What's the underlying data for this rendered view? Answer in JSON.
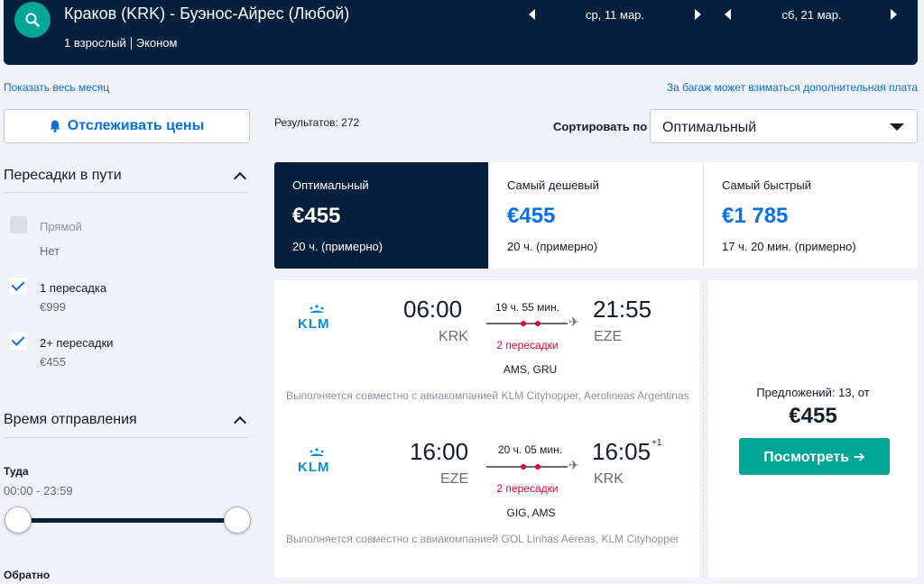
{
  "header": {
    "route": "Краков (KRK) - Буэнос-Айрес (Любой)",
    "passengers": "1 взрослый",
    "cabin": "Эконом",
    "depart_date": "ср, 11 мар.",
    "return_date": "сб, 21 мар."
  },
  "links": {
    "whole_month": "Показать весь месяц",
    "baggage_note": "За багаж может взиматься дополнительная плата"
  },
  "track_button": "Отслеживать цены",
  "filters": {
    "stops": {
      "title": "Пересадки в пути",
      "options": [
        {
          "label": "Прямой",
          "price": "Нет",
          "checked": false
        },
        {
          "label": "1 пересадка",
          "price": "€999",
          "checked": true
        },
        {
          "label": "2+ пересадки",
          "price": "€455",
          "checked": true
        }
      ]
    },
    "departure_time": {
      "title": "Время отправления",
      "outbound_label": "Туда",
      "outbound_range": "00:00 - 23:59",
      "return_label": "Обратно"
    }
  },
  "results": {
    "count_text": "Результатов: 272",
    "sort_label": "Сортировать по",
    "sort_value": "Оптимальный"
  },
  "tabs": [
    {
      "label": "Оптимальный",
      "price": "€455",
      "duration": "20 ч. (примерно)"
    },
    {
      "label": "Самый дешевый",
      "price": "€455",
      "duration": "20 ч. (примерно)"
    },
    {
      "label": "Самый быстрый",
      "price": "€1 785",
      "duration": "17 ч. 20 мин. (примерно)"
    }
  ],
  "itinerary": {
    "outbound": {
      "airline": "KLM",
      "dep_time": "06:00",
      "dep_code": "KRK",
      "duration": "19 ч. 55 мин.",
      "stops": "2 пересадки",
      "via": "AMS, GRU",
      "arr_time": "21:55",
      "arr_code": "EZE",
      "arr_plus": "",
      "note": "Выполняется совместно с авиакомпанией KLM Cityhopper, Aerolineas Argentinas"
    },
    "return": {
      "airline": "KLM",
      "dep_time": "16:00",
      "dep_code": "EZE",
      "duration": "20 ч. 05 мин.",
      "stops": "2 пересадки",
      "via": "GIG, AMS",
      "arr_time": "16:05",
      "arr_code": "KRK",
      "arr_plus": "+1",
      "note": "Выполняется совместно с авиакомпанией GOL Linhas Aéreas, KLM Cityhopper"
    },
    "offers": "Предложений: 13, от",
    "price": "€455",
    "view_button": "Посмотреть ➔"
  },
  "colors": {
    "navy": "#05203c",
    "teal": "#00a698",
    "blue": "#0770e3",
    "red": "#e4003b"
  }
}
